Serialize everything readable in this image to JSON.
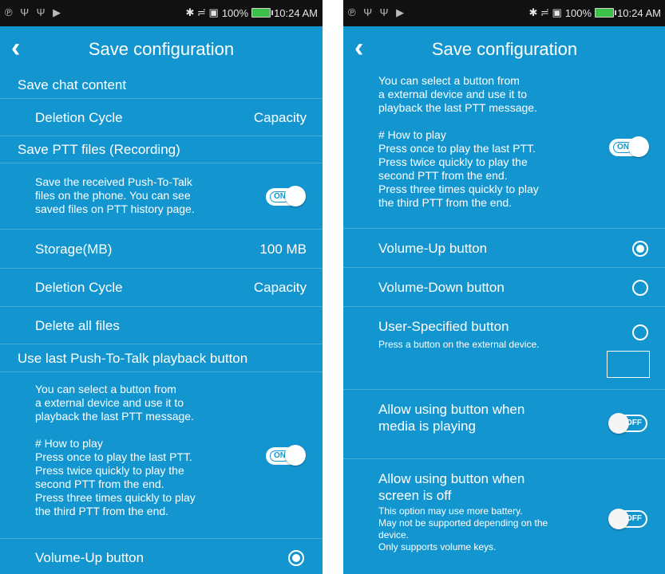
{
  "status_bar": {
    "left_icons": "℗ Ψ Ψ ▶",
    "right_icons": "✱ ≓ ▣",
    "battery": "100%",
    "time": "10:24 AM"
  },
  "app_bar": {
    "back_icon": "chevron-left-icon",
    "title": "Save configuration"
  },
  "left": {
    "save_chat": {
      "title": "Save chat content"
    },
    "chat_deletion": {
      "label": "Deletion Cycle",
      "value": "Capacity"
    },
    "save_ptt": {
      "title": "Save PTT files (Recording)"
    },
    "save_ptt_desc": "Save the received Push-To-Talk\nfiles on the phone. You can see\nsaved files on PTT history page.",
    "save_ptt_toggle": "ON",
    "storage": {
      "label": "Storage(MB)",
      "value": "100 MB"
    },
    "ptt_deletion": {
      "label": "Deletion Cycle",
      "value": "Capacity"
    },
    "delete_all": {
      "label": "Delete all files"
    },
    "playback": {
      "title": "Use last Push-To-Talk playback button"
    },
    "playback_desc": "You can select a button from\na external device and use it to\nplayback the last PTT message.\n\n# How to play\nPress once to play the last PTT.\nPress twice quickly to play the\nsecond PTT from the end.\nPress three times quickly to play\nthe third PTT from the end.",
    "playback_toggle": "ON",
    "volume_up": {
      "label": "Volume-Up button",
      "checked": true
    }
  },
  "right": {
    "playback_desc": "You can select a button from\na external device and use it to\nplayback the last PTT message.\n\n# How to play\nPress once to play the last PTT.\nPress twice quickly to play the\nsecond PTT from the end.\nPress three times quickly to play\nthe third PTT from the end.",
    "playback_toggle": "ON",
    "volume_up": {
      "label": "Volume-Up button",
      "checked": true
    },
    "volume_down": {
      "label": "Volume-Down button",
      "checked": false
    },
    "user_specified": {
      "label": "User-Specified button",
      "desc": "Press a button on the external device.",
      "checked": false
    },
    "media_playing": {
      "label": "Allow using button when\nmedia is playing",
      "toggle": "OFF"
    },
    "screen_off": {
      "label": "Allow using button when\nscreen is off",
      "desc": "This option may use more battery.\nMay not be supported depending on the\ndevice.\nOnly supports volume keys.",
      "toggle": "OFF"
    }
  },
  "colors": {
    "background": "#1396d0",
    "status_bar": "#111111",
    "divider": "#45acd9",
    "battery": "#3cc24a"
  }
}
